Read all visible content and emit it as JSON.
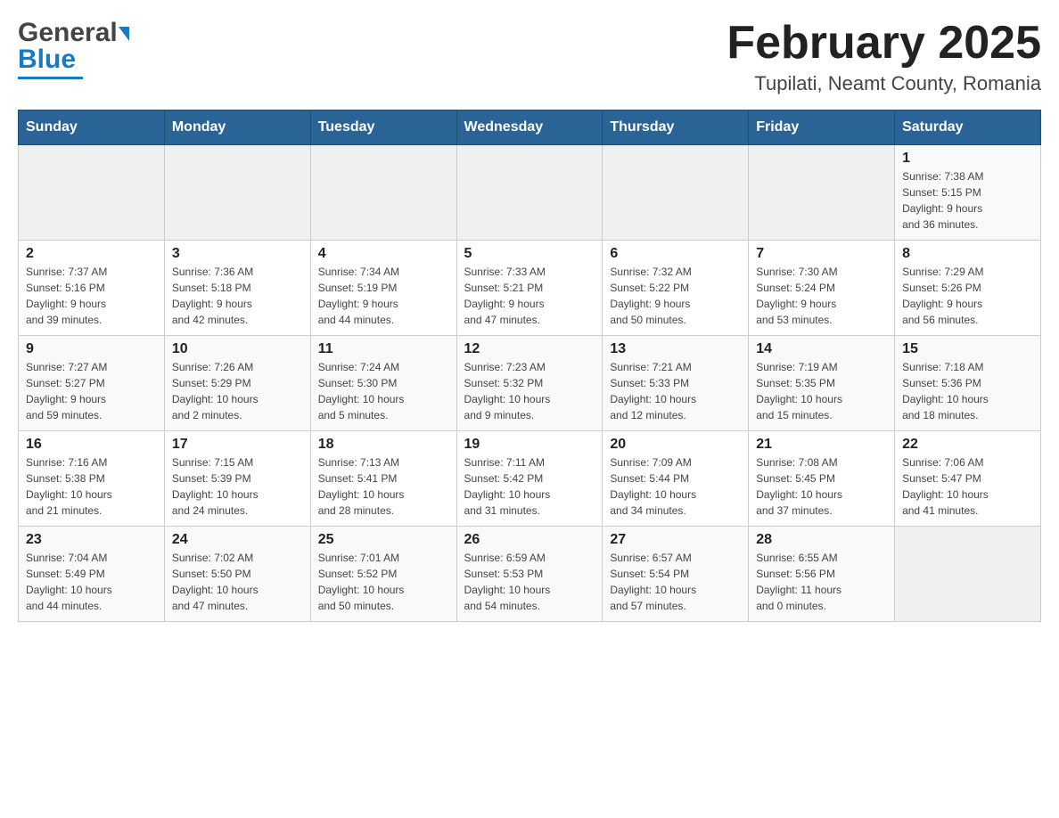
{
  "header": {
    "logo_general": "General",
    "logo_blue": "Blue",
    "month_title": "February 2025",
    "location": "Tupilati, Neamt County, Romania"
  },
  "weekdays": [
    "Sunday",
    "Monday",
    "Tuesday",
    "Wednesday",
    "Thursday",
    "Friday",
    "Saturday"
  ],
  "weeks": [
    {
      "days": [
        {
          "number": "",
          "info": ""
        },
        {
          "number": "",
          "info": ""
        },
        {
          "number": "",
          "info": ""
        },
        {
          "number": "",
          "info": ""
        },
        {
          "number": "",
          "info": ""
        },
        {
          "number": "",
          "info": ""
        },
        {
          "number": "1",
          "info": "Sunrise: 7:38 AM\nSunset: 5:15 PM\nDaylight: 9 hours\nand 36 minutes."
        }
      ]
    },
    {
      "days": [
        {
          "number": "2",
          "info": "Sunrise: 7:37 AM\nSunset: 5:16 PM\nDaylight: 9 hours\nand 39 minutes."
        },
        {
          "number": "3",
          "info": "Sunrise: 7:36 AM\nSunset: 5:18 PM\nDaylight: 9 hours\nand 42 minutes."
        },
        {
          "number": "4",
          "info": "Sunrise: 7:34 AM\nSunset: 5:19 PM\nDaylight: 9 hours\nand 44 minutes."
        },
        {
          "number": "5",
          "info": "Sunrise: 7:33 AM\nSunset: 5:21 PM\nDaylight: 9 hours\nand 47 minutes."
        },
        {
          "number": "6",
          "info": "Sunrise: 7:32 AM\nSunset: 5:22 PM\nDaylight: 9 hours\nand 50 minutes."
        },
        {
          "number": "7",
          "info": "Sunrise: 7:30 AM\nSunset: 5:24 PM\nDaylight: 9 hours\nand 53 minutes."
        },
        {
          "number": "8",
          "info": "Sunrise: 7:29 AM\nSunset: 5:26 PM\nDaylight: 9 hours\nand 56 minutes."
        }
      ]
    },
    {
      "days": [
        {
          "number": "9",
          "info": "Sunrise: 7:27 AM\nSunset: 5:27 PM\nDaylight: 9 hours\nand 59 minutes."
        },
        {
          "number": "10",
          "info": "Sunrise: 7:26 AM\nSunset: 5:29 PM\nDaylight: 10 hours\nand 2 minutes."
        },
        {
          "number": "11",
          "info": "Sunrise: 7:24 AM\nSunset: 5:30 PM\nDaylight: 10 hours\nand 5 minutes."
        },
        {
          "number": "12",
          "info": "Sunrise: 7:23 AM\nSunset: 5:32 PM\nDaylight: 10 hours\nand 9 minutes."
        },
        {
          "number": "13",
          "info": "Sunrise: 7:21 AM\nSunset: 5:33 PM\nDaylight: 10 hours\nand 12 minutes."
        },
        {
          "number": "14",
          "info": "Sunrise: 7:19 AM\nSunset: 5:35 PM\nDaylight: 10 hours\nand 15 minutes."
        },
        {
          "number": "15",
          "info": "Sunrise: 7:18 AM\nSunset: 5:36 PM\nDaylight: 10 hours\nand 18 minutes."
        }
      ]
    },
    {
      "days": [
        {
          "number": "16",
          "info": "Sunrise: 7:16 AM\nSunset: 5:38 PM\nDaylight: 10 hours\nand 21 minutes."
        },
        {
          "number": "17",
          "info": "Sunrise: 7:15 AM\nSunset: 5:39 PM\nDaylight: 10 hours\nand 24 minutes."
        },
        {
          "number": "18",
          "info": "Sunrise: 7:13 AM\nSunset: 5:41 PM\nDaylight: 10 hours\nand 28 minutes."
        },
        {
          "number": "19",
          "info": "Sunrise: 7:11 AM\nSunset: 5:42 PM\nDaylight: 10 hours\nand 31 minutes."
        },
        {
          "number": "20",
          "info": "Sunrise: 7:09 AM\nSunset: 5:44 PM\nDaylight: 10 hours\nand 34 minutes."
        },
        {
          "number": "21",
          "info": "Sunrise: 7:08 AM\nSunset: 5:45 PM\nDaylight: 10 hours\nand 37 minutes."
        },
        {
          "number": "22",
          "info": "Sunrise: 7:06 AM\nSunset: 5:47 PM\nDaylight: 10 hours\nand 41 minutes."
        }
      ]
    },
    {
      "days": [
        {
          "number": "23",
          "info": "Sunrise: 7:04 AM\nSunset: 5:49 PM\nDaylight: 10 hours\nand 44 minutes."
        },
        {
          "number": "24",
          "info": "Sunrise: 7:02 AM\nSunset: 5:50 PM\nDaylight: 10 hours\nand 47 minutes."
        },
        {
          "number": "25",
          "info": "Sunrise: 7:01 AM\nSunset: 5:52 PM\nDaylight: 10 hours\nand 50 minutes."
        },
        {
          "number": "26",
          "info": "Sunrise: 6:59 AM\nSunset: 5:53 PM\nDaylight: 10 hours\nand 54 minutes."
        },
        {
          "number": "27",
          "info": "Sunrise: 6:57 AM\nSunset: 5:54 PM\nDaylight: 10 hours\nand 57 minutes."
        },
        {
          "number": "28",
          "info": "Sunrise: 6:55 AM\nSunset: 5:56 PM\nDaylight: 11 hours\nand 0 minutes."
        },
        {
          "number": "",
          "info": ""
        }
      ]
    }
  ]
}
